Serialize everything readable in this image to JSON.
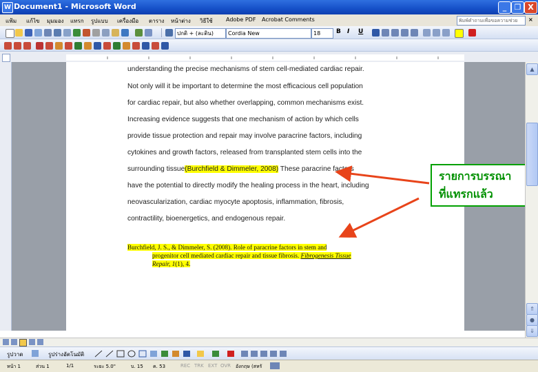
{
  "window": {
    "title": "Document1 - Microsoft Word",
    "controls": {
      "minimize": "_",
      "restore": "❐",
      "close": "X"
    }
  },
  "menubar": {
    "items": [
      "แฟ้ม",
      "แก้ไข",
      "มุมมอง",
      "แทรก",
      "รูปแบบ",
      "เครื่องมือ",
      "ตาราง",
      "หน้าต่าง",
      "วิธีใช้",
      "Adobe PDF",
      "Acrobat Comments"
    ],
    "help_placeholder": "พิมพ์คำถามเพื่อขอความช่วยเหลือ",
    "help_close": "×"
  },
  "format_toolbar": {
    "style_value": "ปกติ + (ละติน)",
    "font_value": "Cordia New",
    "size_value": "18",
    "bold": "B",
    "italic": "I",
    "underline": "U"
  },
  "document": {
    "body_lines": [
      "understanding the precise mechanisms of stem cell-mediated cardiac repair.",
      "Not only will it be important to determine the most efficacious cell population",
      "for cardiac repair, but also whether overlapping, common mechanisms exist.",
      "Increasing evidence suggests that one mechanism of action by which cells",
      "provide tissue protection and repair may involve paracrine factors, including",
      "cytokines and growth factors, released from transplanted stem cells into the"
    ],
    "line7_pre": "surrounding tissue",
    "citation": "(Burchfield & Dimmeler, 2008)",
    "line7_post": " These paracrine factors",
    "line8": "have the potential to directly modify the healing process in the heart, including",
    "line9": "neovascularization, cardiac myocyte apoptosis, inflammation, fibrosis,",
    "line10": "contractility, bioenergetics, and endogenous repair.",
    "reference": {
      "line1": "Burchfield, J. S., & Dimmeler, S. (2008). Role of paracrine factors in stem and",
      "line2": "progenitor cell mediated cardiac repair and tissue fibrosis.",
      "journal": "Fibrogenesis Tissue",
      "line3_journal": "Repair, 1",
      "line3_rest": "(1), 4."
    }
  },
  "annotation": {
    "line1": "รายการบรรณา",
    "line2": "ที่แทรกแล้ว",
    "arrow_color": "#e8441a",
    "text_color": "#009000"
  },
  "drawing_toolbar": {
    "draw_label": "รูปวาด",
    "autoshapes_label": "รูปร่างอัตโนมัติ"
  },
  "statusbar": {
    "page": "หน้า 1",
    "section": "ส่วน 1",
    "page_of": "1/1",
    "at": "ระยะ 5.0\"",
    "line": "บ. 15",
    "col": "ค. 53",
    "rec": "REC",
    "trk": "TRK",
    "ext": "EXT",
    "ovr": "OVR",
    "language": "อังกฤษ (สหรั"
  },
  "colors": {
    "titlebar": "#1650c8",
    "highlight": "#ffff00"
  }
}
